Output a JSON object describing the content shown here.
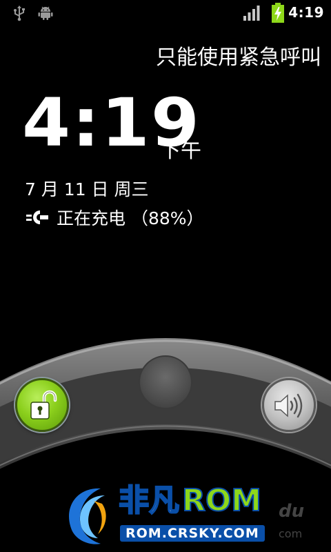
{
  "status_bar": {
    "time": "4:19",
    "icons": [
      "usb-icon",
      "android-debug-icon",
      "signal-icon",
      "battery-charging-icon"
    ]
  },
  "lockscreen": {
    "carrier_text": "只能使用紧急呼叫",
    "time": "4:19",
    "ampm": "下午",
    "date": "7 月 11 日 周三",
    "charging_text": "正在充电 （88%）"
  },
  "unlock": {
    "unlock_icon": "unlock-padlock-icon",
    "sound_icon": "sound-speaker-icon",
    "unlock_color": "#8bcf1c"
  },
  "watermark": {
    "brand_cn": "非凡",
    "brand_rom": "ROM",
    "url": "ROM.CRSKY.COM",
    "baidu_fragment": "du",
    "com_fragment": "com"
  }
}
